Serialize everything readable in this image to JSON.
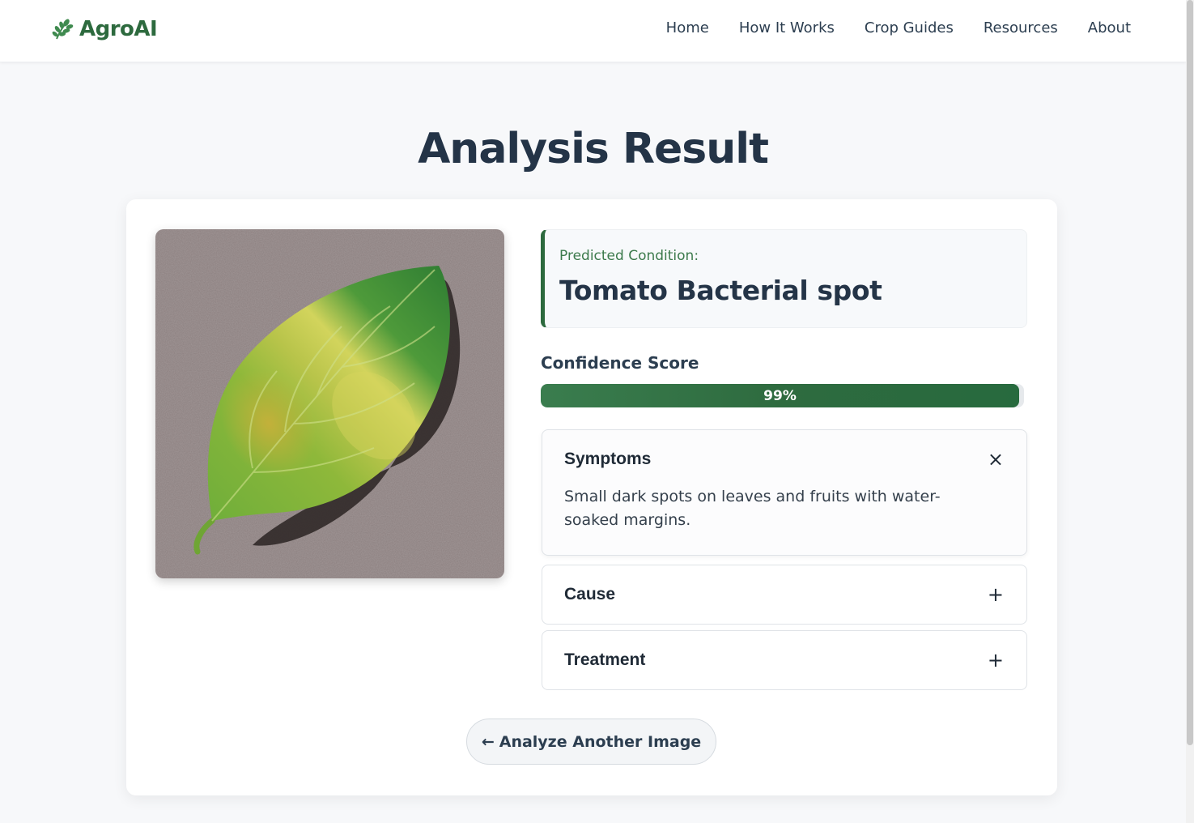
{
  "brand": {
    "name": "AgroAI",
    "icon": "leaf-sprig-icon",
    "color": "#2d6a3e"
  },
  "nav": {
    "items": [
      "Home",
      "How It Works",
      "Crop Guides",
      "Resources",
      "About"
    ]
  },
  "page": {
    "title": "Analysis Result"
  },
  "result": {
    "image": {
      "subject": "leaf-photo"
    },
    "predicted_label": "Predicted Condition:",
    "predicted_value": "Tomato Bacterial spot",
    "confidence_label": "Confidence Score",
    "confidence_value": 0.99,
    "confidence_text": "99%"
  },
  "accordion": [
    {
      "title": "Symptoms",
      "toggle": "×",
      "expanded": true,
      "body": "Small dark spots on leaves and fruits with water-soaked margins."
    },
    {
      "title": "Cause",
      "toggle": "+",
      "expanded": false
    },
    {
      "title": "Treatment",
      "toggle": "+",
      "expanded": false
    }
  ],
  "actions": {
    "analyze_another": "Analyze Another Image",
    "arrow_icon": "arrow-left-icon",
    "arrow": "←"
  },
  "colors": {
    "accent": "#2d6a3e",
    "title": "#243447",
    "background": "#f7f8fa"
  }
}
